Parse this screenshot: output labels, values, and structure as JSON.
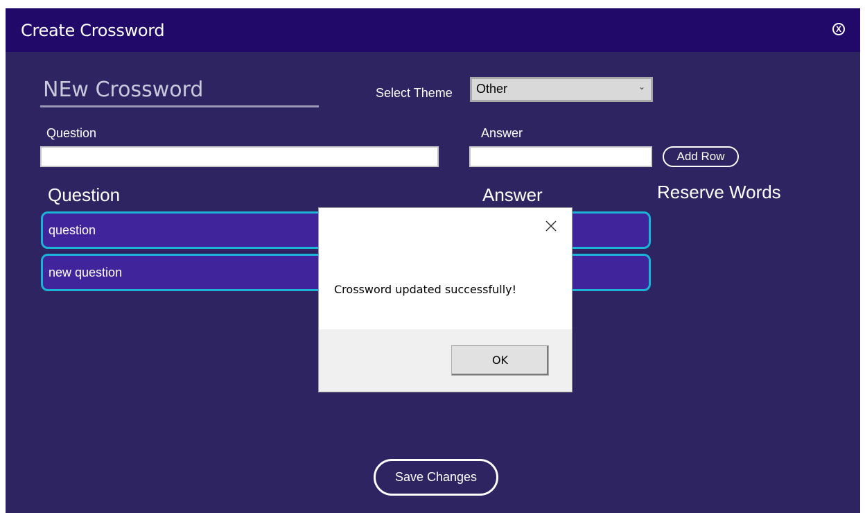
{
  "window": {
    "title": "Create Crossword",
    "close_icon": "close-circle-icon"
  },
  "form": {
    "crossword_name": "NEw Crossword",
    "theme_label": "Select Theme",
    "theme_selected": "Other",
    "question_label": "Question",
    "answer_label": "Answer",
    "question_value": "",
    "answer_value": "",
    "add_row_label": "Add Row"
  },
  "list": {
    "question_header": "Question",
    "answer_header": "Answer",
    "reserve_header": "Reserve Words",
    "rows": [
      {
        "question": "question"
      },
      {
        "question": "new question"
      }
    ]
  },
  "footer": {
    "save_label": "Save Changes"
  },
  "dialog": {
    "message": "Crossword updated successfully!",
    "ok_label": "OK",
    "close_icon": "close-icon"
  },
  "colors": {
    "window_bg": "#2d2461",
    "titlebar_bg": "#21096a",
    "row_bg": "#3f249b",
    "row_border": "#1bb3d6"
  }
}
